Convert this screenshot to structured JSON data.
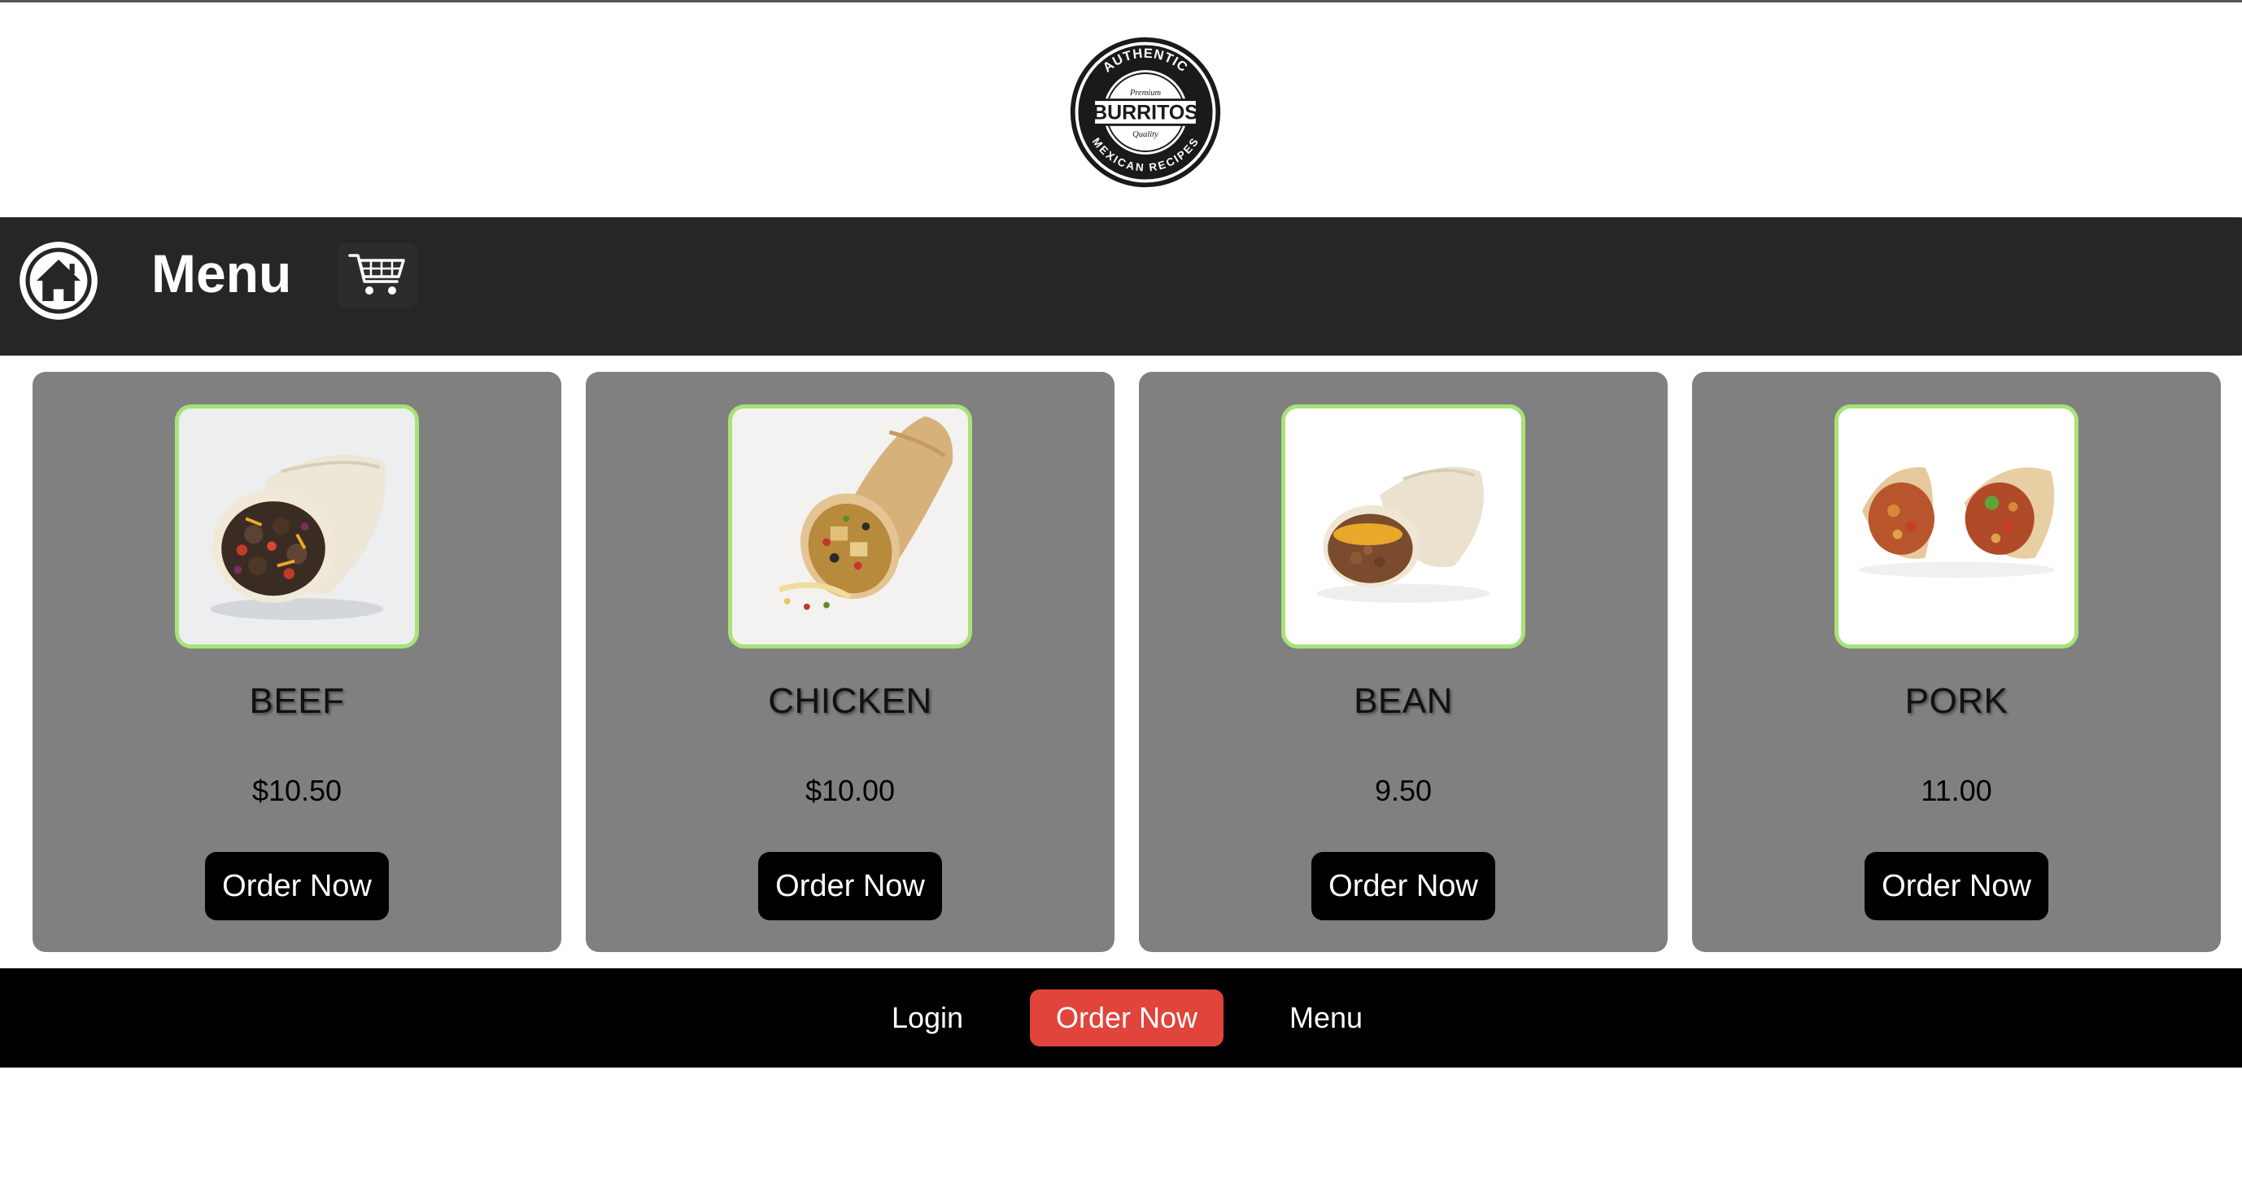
{
  "logo": {
    "alt": "Authentic Premium Burritos Quality Mexican Recipes",
    "top_arc": "AUTHENTIC",
    "premium": "Premium",
    "brand": "BURRITOS",
    "quality": "Quality",
    "bottom_arc": "MEXICAN RECIPES"
  },
  "header": {
    "home_icon": "home-icon",
    "title": "Menu",
    "cart_icon": "cart-icon"
  },
  "items": [
    {
      "name": "BEEF",
      "price": "$10.50",
      "button": "Order Now"
    },
    {
      "name": "CHICKEN",
      "price": "$10.00",
      "button": "Order Now"
    },
    {
      "name": "BEAN",
      "price": "9.50",
      "button": "Order Now"
    },
    {
      "name": "PORK",
      "price": "11.00",
      "button": "Order Now"
    }
  ],
  "footer": {
    "login": "Login",
    "order_now": "Order Now",
    "menu": "Menu"
  },
  "colors": {
    "header_bg": "#262626",
    "card_bg": "#808080",
    "thumb_border": "#a7e378",
    "footer_bg": "#000000",
    "accent": "#e0443b"
  }
}
